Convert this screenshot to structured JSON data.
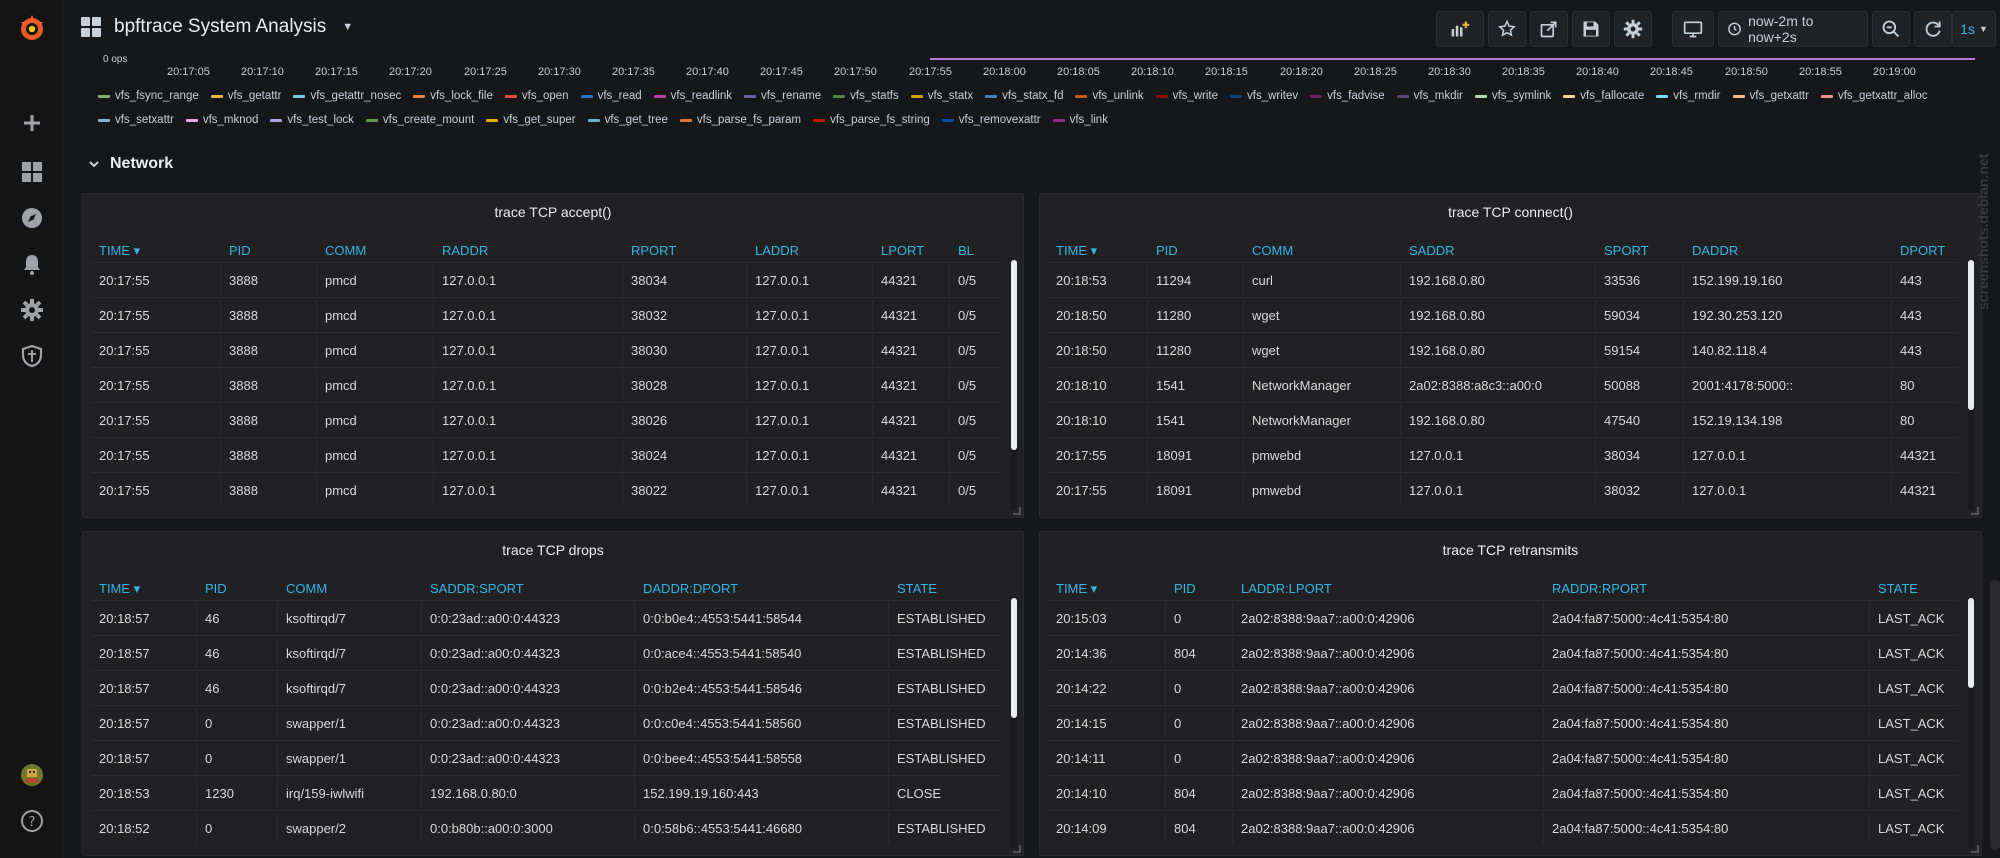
{
  "app": {
    "title": "bpftrace System Analysis"
  },
  "toolbar": {
    "time_range": "now-2m to now+2s",
    "refresh": "1s"
  },
  "axis_ticks": [
    "0 ops",
    "20:17:05",
    "20:17:10",
    "20:17:15",
    "20:17:20",
    "20:17:25",
    "20:17:30",
    "20:17:35",
    "20:17:40",
    "20:17:45",
    "20:17:50",
    "20:17:55",
    "20:18:00",
    "20:18:05",
    "20:18:10",
    "20:18:15",
    "20:18:20",
    "20:18:25",
    "20:18:30",
    "20:18:35",
    "20:18:40",
    "20:18:45",
    "20:18:50",
    "20:18:55",
    "20:19:00"
  ],
  "legend": [
    {
      "label": "vfs_fsync_range",
      "color": "#7eb26d"
    },
    {
      "label": "vfs_getattr",
      "color": "#eab839"
    },
    {
      "label": "vfs_getattr_nosec",
      "color": "#6ed0e0"
    },
    {
      "label": "vfs_lock_file",
      "color": "#ef843c"
    },
    {
      "label": "vfs_open",
      "color": "#e24d42"
    },
    {
      "label": "vfs_read",
      "color": "#1f78c1"
    },
    {
      "label": "vfs_readlink",
      "color": "#ba43a9"
    },
    {
      "label": "vfs_rename",
      "color": "#705da0"
    },
    {
      "label": "vfs_statfs",
      "color": "#508642"
    },
    {
      "label": "vfs_statx",
      "color": "#cca300"
    },
    {
      "label": "vfs_statx_fd",
      "color": "#447ebc"
    },
    {
      "label": "vfs_unlink",
      "color": "#c15c17"
    },
    {
      "label": "vfs_write",
      "color": "#890f02"
    },
    {
      "label": "vfs_writev",
      "color": "#0a437c"
    },
    {
      "label": "vfs_fadvise",
      "color": "#6d1f62"
    },
    {
      "label": "vfs_mkdir",
      "color": "#584477"
    },
    {
      "label": "vfs_symlink",
      "color": "#b7dbab"
    },
    {
      "label": "vfs_fallocate",
      "color": "#f4d598"
    },
    {
      "label": "vfs_rmdir",
      "color": "#70dbed"
    },
    {
      "label": "vfs_getxattr",
      "color": "#f9ba8f"
    },
    {
      "label": "vfs_getxattr_alloc",
      "color": "#f29191"
    },
    {
      "label": "vfs_setxattr",
      "color": "#82b5d8"
    },
    {
      "label": "vfs_mknod",
      "color": "#e5a8e2"
    },
    {
      "label": "vfs_test_lock",
      "color": "#aea2e0"
    },
    {
      "label": "vfs_create_mount",
      "color": "#629e51"
    },
    {
      "label": "vfs_get_super",
      "color": "#e5ac0e"
    },
    {
      "label": "vfs_get_tree",
      "color": "#64b0c8"
    },
    {
      "label": "vfs_parse_fs_param",
      "color": "#e0752d"
    },
    {
      "label": "vfs_parse_fs_string",
      "color": "#bf1b00"
    },
    {
      "label": "vfs_removexattr",
      "color": "#0a50a1"
    },
    {
      "label": "vfs_link",
      "color": "#962d82"
    }
  ],
  "row": {
    "title": "Network"
  },
  "panels": {
    "accept": {
      "title": "trace TCP accept()",
      "headers": [
        "TIME",
        "PID",
        "COMM",
        "RADDR",
        "RPORT",
        "LADDR",
        "LPORT",
        "BL"
      ],
      "rows": [
        [
          "20:17:55",
          "3888",
          "pmcd",
          "127.0.0.1",
          "38034",
          "127.0.0.1",
          "44321",
          "0/5"
        ],
        [
          "20:17:55",
          "3888",
          "pmcd",
          "127.0.0.1",
          "38032",
          "127.0.0.1",
          "44321",
          "0/5"
        ],
        [
          "20:17:55",
          "3888",
          "pmcd",
          "127.0.0.1",
          "38030",
          "127.0.0.1",
          "44321",
          "0/5"
        ],
        [
          "20:17:55",
          "3888",
          "pmcd",
          "127.0.0.1",
          "38028",
          "127.0.0.1",
          "44321",
          "0/5"
        ],
        [
          "20:17:55",
          "3888",
          "pmcd",
          "127.0.0.1",
          "38026",
          "127.0.0.1",
          "44321",
          "0/5"
        ],
        [
          "20:17:55",
          "3888",
          "pmcd",
          "127.0.0.1",
          "38024",
          "127.0.0.1",
          "44321",
          "0/5"
        ],
        [
          "20:17:55",
          "3888",
          "pmcd",
          "127.0.0.1",
          "38022",
          "127.0.0.1",
          "44321",
          "0/5"
        ]
      ]
    },
    "connect": {
      "title": "trace TCP connect()",
      "headers": [
        "TIME",
        "PID",
        "COMM",
        "SADDR",
        "SPORT",
        "DADDR",
        "DPORT"
      ],
      "rows": [
        [
          "20:18:53",
          "11294",
          "curl",
          "192.168.0.80",
          "33536",
          "152.199.19.160",
          "443"
        ],
        [
          "20:18:50",
          "11280",
          "wget",
          "192.168.0.80",
          "59034",
          "192.30.253.120",
          "443"
        ],
        [
          "20:18:50",
          "11280",
          "wget",
          "192.168.0.80",
          "59154",
          "140.82.118.4",
          "443"
        ],
        [
          "20:18:10",
          "1541",
          "NetworkManager",
          "2a02:8388:a8c3::a00:0",
          "50088",
          "2001:4178:5000::",
          "80"
        ],
        [
          "20:18:10",
          "1541",
          "NetworkManager",
          "192.168.0.80",
          "47540",
          "152.19.134.198",
          "80"
        ],
        [
          "20:17:55",
          "18091",
          "pmwebd",
          "127.0.0.1",
          "38034",
          "127.0.0.1",
          "44321"
        ],
        [
          "20:17:55",
          "18091",
          "pmwebd",
          "127.0.0.1",
          "38032",
          "127.0.0.1",
          "44321"
        ]
      ]
    },
    "drops": {
      "title": "trace TCP drops",
      "headers": [
        "TIME",
        "PID",
        "COMM",
        "SADDR:SPORT",
        "DADDR:DPORT",
        "STATE"
      ],
      "rows": [
        [
          "20:18:57",
          "46",
          "ksoftirqd/7",
          "0:0:23ad::a00:0:44323",
          "0:0:b0e4::4553:5441:58544",
          "ESTABLISHED"
        ],
        [
          "20:18:57",
          "46",
          "ksoftirqd/7",
          "0:0:23ad::a00:0:44323",
          "0:0:ace4::4553:5441:58540",
          "ESTABLISHED"
        ],
        [
          "20:18:57",
          "46",
          "ksoftirqd/7",
          "0:0:23ad::a00:0:44323",
          "0:0:b2e4::4553:5441:58546",
          "ESTABLISHED"
        ],
        [
          "20:18:57",
          "0",
          "swapper/1",
          "0:0:23ad::a00:0:44323",
          "0:0:c0e4::4553:5441:58560",
          "ESTABLISHED"
        ],
        [
          "20:18:57",
          "0",
          "swapper/1",
          "0:0:23ad::a00:0:44323",
          "0:0:bee4::4553:5441:58558",
          "ESTABLISHED"
        ],
        [
          "20:18:53",
          "1230",
          "irq/159-iwlwifi",
          "192.168.0.80:0",
          "152.199.19.160:443",
          "CLOSE"
        ],
        [
          "20:18:52",
          "0",
          "swapper/2",
          "0:0:b80b::a00:0:3000",
          "0:0:58b6::4553:5441:46680",
          "ESTABLISHED"
        ]
      ]
    },
    "retransmits": {
      "title": "trace TCP retransmits",
      "headers": [
        "TIME",
        "PID",
        "LADDR:LPORT",
        "RADDR:RPORT",
        "STATE"
      ],
      "rows": [
        [
          "20:15:03",
          "0",
          "2a02:8388:9aa7::a00:0:42906",
          "2a04:fa87:5000::4c41:5354:80",
          "LAST_ACK"
        ],
        [
          "20:14:36",
          "804",
          "2a02:8388:9aa7::a00:0:42906",
          "2a04:fa87:5000::4c41:5354:80",
          "LAST_ACK"
        ],
        [
          "20:14:22",
          "0",
          "2a02:8388:9aa7::a00:0:42906",
          "2a04:fa87:5000::4c41:5354:80",
          "LAST_ACK"
        ],
        [
          "20:14:15",
          "0",
          "2a02:8388:9aa7::a00:0:42906",
          "2a04:fa87:5000::4c41:5354:80",
          "LAST_ACK"
        ],
        [
          "20:14:11",
          "0",
          "2a02:8388:9aa7::a00:0:42906",
          "2a04:fa87:5000::4c41:5354:80",
          "LAST_ACK"
        ],
        [
          "20:14:10",
          "804",
          "2a02:8388:9aa7::a00:0:42906",
          "2a04:fa87:5000::4c41:5354:80",
          "LAST_ACK"
        ],
        [
          "20:14:09",
          "804",
          "2a02:8388:9aa7::a00:0:42906",
          "2a04:fa87:5000::4c41:5354:80",
          "LAST_ACK"
        ]
      ]
    }
  },
  "watermark": "screenshots.debian.net",
  "colors": {
    "accent": "#33b5e5",
    "series_line": "#b877d9",
    "logo": "#f05a28"
  }
}
